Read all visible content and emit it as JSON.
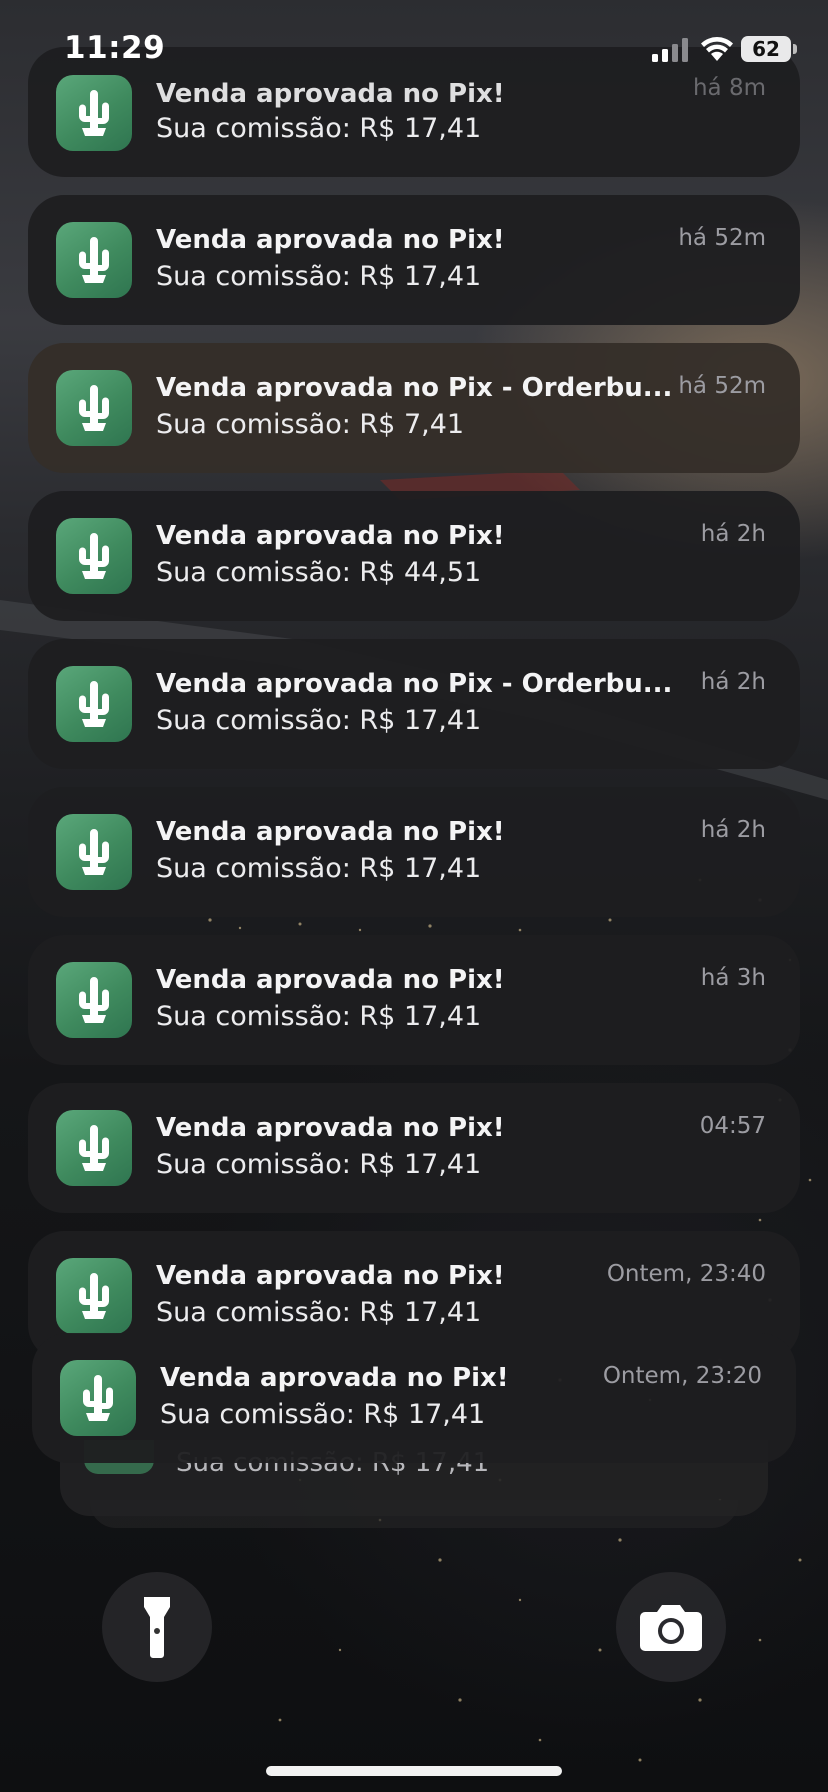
{
  "status_bar": {
    "time": "11:29",
    "battery": "62"
  },
  "notifications": [
    {
      "title": "Venda aprovada no Pix!",
      "body": "Sua comissão: R$ 17,41",
      "time": "há 8m",
      "app_icon": "cactus-icon"
    },
    {
      "title": "Venda aprovada no Pix!",
      "body": "Sua comissão: R$ 17,41",
      "time": "há 52m",
      "app_icon": "cactus-icon"
    },
    {
      "title": "Venda aprovada no Pix - Orderbu...",
      "body": "Sua comissão: R$ 7,41",
      "time": "há 52m",
      "app_icon": "cactus-icon"
    },
    {
      "title": "Venda aprovada no Pix!",
      "body": "Sua comissão: R$ 44,51",
      "time": "há 2h",
      "app_icon": "cactus-icon"
    },
    {
      "title": "Venda aprovada no Pix - Orderbu...",
      "body": "Sua comissão: R$ 17,41",
      "time": "há 2h",
      "app_icon": "cactus-icon"
    },
    {
      "title": "Venda aprovada no Pix!",
      "body": "Sua comissão: R$ 17,41",
      "time": "há 2h",
      "app_icon": "cactus-icon"
    },
    {
      "title": "Venda aprovada no Pix!",
      "body": "Sua comissão: R$ 17,41",
      "time": "há 3h",
      "app_icon": "cactus-icon"
    },
    {
      "title": "Venda aprovada no Pix!",
      "body": "Sua comissão: R$ 17,41",
      "time": "04:57",
      "app_icon": "cactus-icon"
    },
    {
      "title": "Venda aprovada no Pix!",
      "body": "Sua comissão: R$ 17,41",
      "time": "Ontem, 23:40",
      "app_icon": "cactus-icon"
    },
    {
      "title": "Venda aprovada no Pix!",
      "body": "Sua comissão: R$ 17,41",
      "time": "Ontem, 23:20",
      "app_icon": "cactus-icon"
    }
  ],
  "stacked_notification": {
    "body": "Sua comissão: R$ 17,41"
  },
  "lock_screen_buttons": {
    "left": "flashlight-icon",
    "right": "camera-icon"
  },
  "colors": {
    "app_icon_green": "#4a9a6c",
    "notification_bg": "#1e1e20",
    "time_label": "#9c9ca2"
  }
}
